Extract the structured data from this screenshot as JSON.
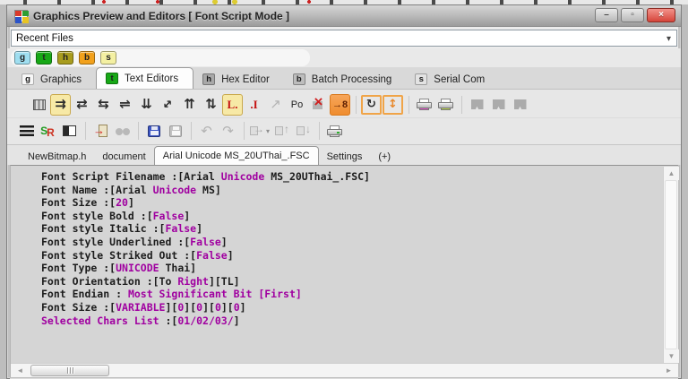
{
  "window": {
    "title": "Graphics Preview and Editors [ Font Script Mode ]",
    "minimize_label": "–",
    "maximize_label": "▫",
    "close_label": "×"
  },
  "recent_files": {
    "value": "Recent Files",
    "caret": "▾"
  },
  "quick_buttons": [
    {
      "label": "g",
      "bg": "#9fdef0"
    },
    {
      "label": "t",
      "bg": "#17a816"
    },
    {
      "label": "h",
      "bg": "#a89c1e"
    },
    {
      "label": "b",
      "bg": "#f2a11c"
    },
    {
      "label": "s",
      "bg": "#f4f0a2"
    }
  ],
  "main_tabs": [
    {
      "label": "Graphics",
      "badge": "g",
      "badge_bg": "#f7f7f7",
      "active": false
    },
    {
      "label": "Text Editors",
      "badge": "t",
      "badge_bg": "#17a816",
      "active": true
    },
    {
      "label": "Hex Editor",
      "badge": "h",
      "badge_bg": "#a9a9a9",
      "active": false
    },
    {
      "label": "Batch Processing",
      "badge": "b",
      "badge_bg": "#bdbdbd",
      "active": false
    },
    {
      "label": "Serial Com",
      "badge": "s",
      "badge_bg": "#e3e3e3",
      "active": false
    }
  ],
  "toolbar_row1": [
    {
      "name": "char-grid-icon",
      "kind": "grid"
    },
    {
      "name": "arrows-right-icon",
      "kind": "glyph",
      "glyph": "⇉",
      "selected": true
    },
    {
      "name": "arrows-swap-icon",
      "kind": "glyph",
      "glyph": "⇄"
    },
    {
      "name": "arrows-leftright-icon",
      "kind": "glyph",
      "glyph": "⇆"
    },
    {
      "name": "arrows-crossed-icon",
      "kind": "glyph",
      "glyph": "⇌"
    },
    {
      "name": "arrows-down-icon",
      "kind": "glyph",
      "glyph": "⇊"
    },
    {
      "name": "arrows-diagonal-icon",
      "kind": "glyph",
      "glyph": "↔",
      "rot45": true
    },
    {
      "name": "arrows-up-icon",
      "kind": "glyph",
      "glyph": "⇈"
    },
    {
      "name": "arrows-updown-icon",
      "kind": "glyph",
      "glyph": "⇅"
    },
    {
      "name": "left-baseline-icon",
      "kind": "lmark",
      "glyph": "L.",
      "selected": true
    },
    {
      "name": "right-baseline-icon",
      "kind": "imark",
      "glyph": ".I"
    },
    {
      "name": "transform-disabled-icon",
      "kind": "glyph",
      "glyph": "↗",
      "disabled": true
    },
    {
      "name": "po-icon",
      "kind": "text",
      "glyph": "Po"
    },
    {
      "name": "delete-char-icon",
      "kind": "xmark"
    },
    {
      "name": "plus8-icon",
      "kind": "plus8",
      "glyph": "→8"
    },
    {
      "name": "toolbar-separator",
      "kind": "sep"
    },
    {
      "name": "refresh-box-icon",
      "kind": "boxglyph",
      "glyph": "↻",
      "orange": false
    },
    {
      "name": "resize-box-icon",
      "kind": "boxglyph",
      "glyph": "↕",
      "orange": true
    },
    {
      "name": "toolbar-separator",
      "kind": "sep"
    },
    {
      "name": "print-magenta-icon",
      "kind": "printer",
      "variant": "magenta"
    },
    {
      "name": "print-green-icon",
      "kind": "printer",
      "variant": "green"
    },
    {
      "name": "toolbar-separator",
      "kind": "sep"
    },
    {
      "name": "flag-icon",
      "kind": "flag"
    },
    {
      "name": "flag-icon",
      "kind": "flag"
    },
    {
      "name": "flag-icon",
      "kind": "flag"
    }
  ],
  "toolbar_row2": [
    {
      "name": "menu-icon",
      "kind": "bars"
    },
    {
      "name": "sr-icon",
      "kind": "sr",
      "glyph_s": "S",
      "glyph_r": "R"
    },
    {
      "name": "split-view-icon",
      "kind": "split"
    },
    {
      "name": "toolbar-separator",
      "kind": "sep"
    },
    {
      "name": "import-door-icon",
      "kind": "door",
      "glyph": "→"
    },
    {
      "name": "find-icon",
      "kind": "binoc",
      "disabled": true
    },
    {
      "name": "toolbar-separator",
      "kind": "sep"
    },
    {
      "name": "save-icon",
      "kind": "floppy",
      "variant": "blue"
    },
    {
      "name": "save-all-icon",
      "kind": "floppy",
      "variant": "gray",
      "disabled": true
    },
    {
      "name": "toolbar-separator",
      "kind": "sep"
    },
    {
      "name": "undo-icon",
      "kind": "glyph",
      "glyph": "↶",
      "disabled": true
    },
    {
      "name": "redo-icon",
      "kind": "glyph",
      "glyph": "↷",
      "disabled": true
    },
    {
      "name": "toolbar-separator",
      "kind": "sep"
    },
    {
      "name": "export-icon",
      "kind": "pagearrow",
      "glyph": "→",
      "caret": "▾",
      "disabled": true
    },
    {
      "name": "move-up-icon",
      "kind": "pagearrow",
      "glyph": "↑",
      "disabled": true
    },
    {
      "name": "move-down-icon",
      "kind": "pagearrow",
      "glyph": "↓",
      "disabled": true
    },
    {
      "name": "toolbar-separator",
      "kind": "sep"
    },
    {
      "name": "print-icon",
      "kind": "printer",
      "variant": "plain"
    }
  ],
  "doc_tabs": [
    {
      "label": "NewBitmap.h",
      "active": false
    },
    {
      "label": "document",
      "active": false
    },
    {
      "label": "Arial Unicode MS_20UThai_.FSC",
      "active": true
    },
    {
      "label": "Settings",
      "active": false
    },
    {
      "label": "(+)",
      "active": false
    }
  ],
  "editor": {
    "lines": [
      [
        {
          "t": "Font Script Filename :[Arial ",
          "c": "k"
        },
        {
          "t": "Unicode",
          "c": "m"
        },
        {
          "t": " MS_20UThai_.FSC]",
          "c": "k"
        }
      ],
      [
        {
          "t": "Font Name :[Arial ",
          "c": "k"
        },
        {
          "t": "Unicode",
          "c": "m"
        },
        {
          "t": " MS]",
          "c": "k"
        }
      ],
      [
        {
          "t": "Font Size :[",
          "c": "k"
        },
        {
          "t": "20",
          "c": "m"
        },
        {
          "t": "]",
          "c": "k"
        }
      ],
      [
        {
          "t": "Font style Bold :[",
          "c": "k"
        },
        {
          "t": "False",
          "c": "m"
        },
        {
          "t": "]",
          "c": "k"
        }
      ],
      [
        {
          "t": "Font style Italic :[",
          "c": "k"
        },
        {
          "t": "False",
          "c": "m"
        },
        {
          "t": "]",
          "c": "k"
        }
      ],
      [
        {
          "t": "Font style Underlined :[",
          "c": "k"
        },
        {
          "t": "False",
          "c": "m"
        },
        {
          "t": "]",
          "c": "k"
        }
      ],
      [
        {
          "t": "Font style Striked Out :[",
          "c": "k"
        },
        {
          "t": "False",
          "c": "m"
        },
        {
          "t": "]",
          "c": "k"
        }
      ],
      [
        {
          "t": "Font Type :[",
          "c": "k"
        },
        {
          "t": "UNICODE",
          "c": "m"
        },
        {
          "t": " Thai]",
          "c": "k"
        }
      ],
      [
        {
          "t": "Font Orientation :[To ",
          "c": "k"
        },
        {
          "t": "Right",
          "c": "m"
        },
        {
          "t": "][TL]",
          "c": "k"
        }
      ],
      [
        {
          "t": "Font Endian : ",
          "c": "k"
        },
        {
          "t": "Most Significant Bit [First]",
          "c": "m"
        }
      ],
      [
        {
          "t": "Font Size :[",
          "c": "k"
        },
        {
          "t": "VARIABLE",
          "c": "m"
        },
        {
          "t": "][",
          "c": "k"
        },
        {
          "t": "0",
          "c": "m"
        },
        {
          "t": "][",
          "c": "k"
        },
        {
          "t": "0",
          "c": "m"
        },
        {
          "t": "][",
          "c": "k"
        },
        {
          "t": "0",
          "c": "m"
        },
        {
          "t": "][",
          "c": "k"
        },
        {
          "t": "0",
          "c": "m"
        },
        {
          "t": "]",
          "c": "k"
        }
      ],
      [
        {
          "t": "Selected Chars List ",
          "c": "m"
        },
        {
          "t": ":[",
          "c": "k"
        },
        {
          "t": "01/02/03/",
          "c": "m"
        },
        {
          "t": "]",
          "c": "k"
        }
      ]
    ],
    "scrollbar_glyphs": {
      "up": "▲",
      "down": "▼",
      "left": "◄",
      "right": "►"
    }
  },
  "colors": {
    "accent_magenta": "#a000a0",
    "selected_toolbar_bg": "#f7e9a6",
    "close_button": "#d6453a",
    "tab_green": "#17a816",
    "plus8_orange": "#ef8c2e"
  }
}
